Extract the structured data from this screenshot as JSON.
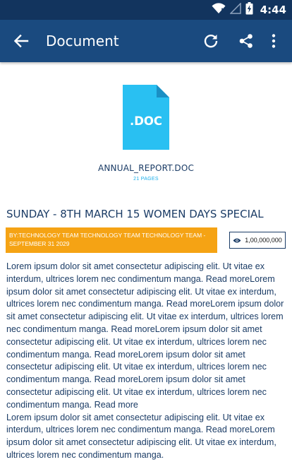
{
  "status_bar": {
    "time": "4:44",
    "icons": [
      "wifi-icon",
      "signal-icon",
      "battery-icon"
    ]
  },
  "toolbar": {
    "title": "Document",
    "back_icon": "arrow-left-icon",
    "actions": [
      "refresh-icon",
      "share-icon",
      "more-vert-icon"
    ]
  },
  "document": {
    "icon_label": ".DOC",
    "file_name": "ANNUAL_REPORT.DOC",
    "pages": "21 PAGES"
  },
  "article": {
    "headline": "SUNDAY - 8TH MARCH 15 WOMEN DAYS SPECIAL",
    "byline": "BY:TECHNOLOGY TEAM TECHNOLOGY TEAM TECHNOLOGY TEAM - SEPTEMBER 31 2029",
    "views": "1,00,000,000",
    "paragraphs": [
      "Lorem ipsum dolor sit amet consectetur adipiscing elit. Ut vitae ex interdum, ultrices lorem nec condimentum manga. Read moreLorem ipsum dolor sit amet consectetur adipiscing elit. Ut vitae ex interdum, ultrices lorem nec condimentum manga. Read moreLorem ipsum dolor sit amet consectetur adipiscing elit. Ut vitae ex interdum, ultrices lorem nec condimentum manga. Read moreLorem ipsum dolor sit amet consectetur adipiscing elit. Ut vitae ex interdum, ultrices lorem nec condimentum manga. Read moreLorem ipsum dolor sit amet consectetur adipiscing elit. Ut vitae ex interdum, ultrices lorem nec condimentum manga. Read moreLorem ipsum dolor sit amet consectetur adipiscing elit. Ut vitae ex interdum, ultrices lorem nec condimentum manga. Read more",
      "Lorem ipsum dolor sit amet consectetur adipiscing elit. Ut vitae ex interdum, ultrices lorem nec condimentum manga. Read moreLorem ipsum dolor sit amet consectetur adipiscing elit. Ut vitae ex interdum, ultrices lorem nec condimentum manga."
    ]
  },
  "colors": {
    "status_bar": "#12345e",
    "toolbar": "#1a4a7f",
    "accent_blue": "#1aaeea",
    "doc_icon": "#29c0f2",
    "byline_bg": "#f5a314",
    "text": "#1b3c66"
  }
}
